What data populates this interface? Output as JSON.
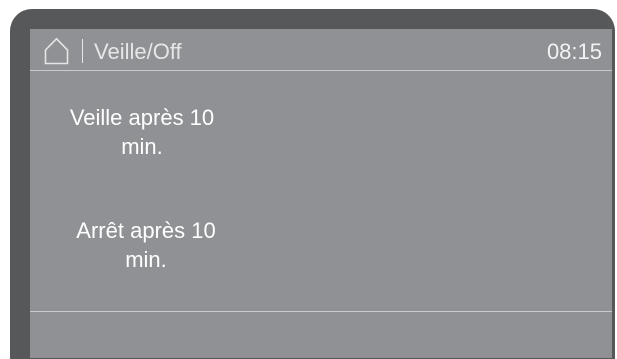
{
  "header": {
    "home_icon": "home-icon",
    "title": "Veille/Off",
    "clock": "08:15"
  },
  "menu": {
    "items": [
      {
        "line1": "Veille après 10",
        "line2": "min."
      },
      {
        "line1": "Arrêt après 10",
        "line2": "min."
      }
    ]
  },
  "colors": {
    "bezel": "#57585a",
    "screen": "#8f9194",
    "text": "#ffffff",
    "rule": "#c9cacb"
  }
}
